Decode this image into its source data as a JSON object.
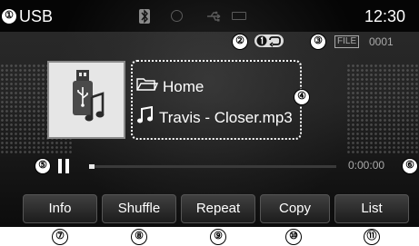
{
  "status_bar": {
    "source": "USB",
    "clock": "12:30",
    "icons": [
      "bluetooth-icon",
      "disc-icon",
      "usb-icon",
      "battery-icon"
    ]
  },
  "media": {
    "repeat_mode_icon": "repeat-one-icon",
    "file_tag": "FILE",
    "file_number": "0001",
    "folder": "Home",
    "song": "Travis - Closer.mp3",
    "elapsed_time": "0:00:00",
    "progress": 0,
    "album_art_icon": "usb-drive-music-icon"
  },
  "softkeys": [
    {
      "label": "Info"
    },
    {
      "label": "Shuffle"
    },
    {
      "label": "Repeat"
    },
    {
      "label": "Copy"
    },
    {
      "label": "List"
    }
  ],
  "callouts": [
    "①",
    "②",
    "③",
    "④",
    "⑤",
    "⑥",
    "⑦",
    "⑧",
    "⑨",
    "⑩",
    "⑪"
  ],
  "colors": {
    "screen_background": "#1e1e1e",
    "text": "#ffffff",
    "secondary_text": "#aaaaaa",
    "softkey_background": "#2e2e2e"
  }
}
